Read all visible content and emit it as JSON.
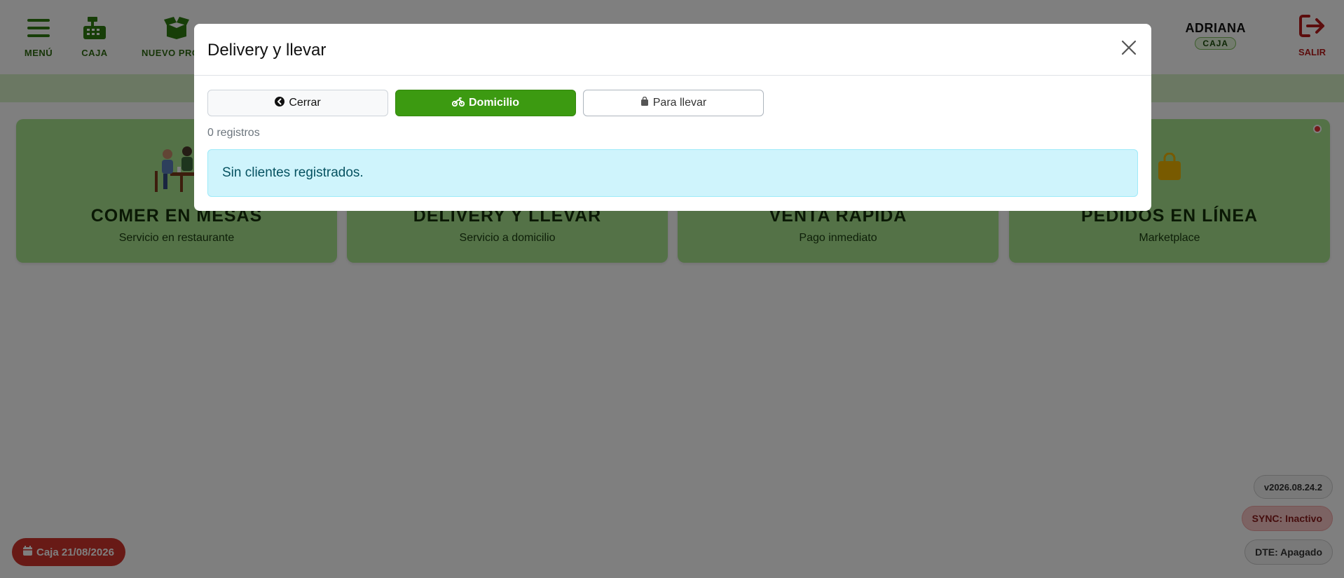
{
  "nav": {
    "items": [
      {
        "label": "MENÚ",
        "icon": "hamburger-icon"
      },
      {
        "label": "CAJA",
        "icon": "cash-register-icon"
      },
      {
        "label": "NUEVO PROD",
        "icon": "box-open-icon"
      }
    ],
    "user": {
      "name": "ADRIANA",
      "role": "CAJA"
    },
    "logout_label": "SALIR"
  },
  "cards": [
    {
      "title": "COMER EN MESAS",
      "subtitle": "Servicio en restaurante",
      "icon": "dining-table-icon"
    },
    {
      "title": "DELIVERY Y LLEVAR",
      "subtitle": "Servicio a domicilio",
      "icon": "motorcycle-icon"
    },
    {
      "title": "VENTA RAPIDA",
      "subtitle": "Pago inmediato",
      "icon": "bolt-icon"
    },
    {
      "title": "PEDIDOS EN LÍNEA",
      "subtitle": "Marketplace",
      "icon": "shopping-bag-icon"
    }
  ],
  "footer": {
    "caja_label": "Caja 21/08/2026",
    "version": "v2026.08.24.2",
    "sync": "SYNC: Inactivo",
    "dte": "DTE: Apagado"
  },
  "modal": {
    "title": "Delivery y llevar",
    "buttons": {
      "close": "Cerrar",
      "delivery": "Domicilio",
      "takeaway": "Para llevar"
    },
    "count": "0 registros",
    "empty_message": "Sin clientes registrados."
  },
  "colors": {
    "brand_green": "#3c9a11",
    "card_green": "#a9e48e",
    "danger": "#d0342c",
    "info_bg": "#cff4fc"
  }
}
